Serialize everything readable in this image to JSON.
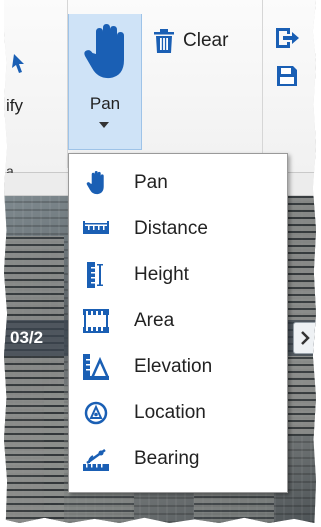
{
  "ribbon": {
    "pan_label": "Pan",
    "clear_label": "Clear",
    "partial_left_label": "ify",
    "partial_lower_label": "a"
  },
  "map": {
    "date_text": "03/2"
  },
  "menu": {
    "items": [
      {
        "label": "Pan",
        "icon": "hand-icon"
      },
      {
        "label": "Distance",
        "icon": "ruler-icon"
      },
      {
        "label": "Height",
        "icon": "vertical-ruler-icon"
      },
      {
        "label": "Area",
        "icon": "area-icon"
      },
      {
        "label": "Elevation",
        "icon": "elevation-icon"
      },
      {
        "label": "Location",
        "icon": "location-icon"
      },
      {
        "label": "Bearing",
        "icon": "bearing-icon"
      }
    ]
  },
  "colors": {
    "accent_blue": "#1a5fb4",
    "selected_bg": "#cfe3f7"
  }
}
